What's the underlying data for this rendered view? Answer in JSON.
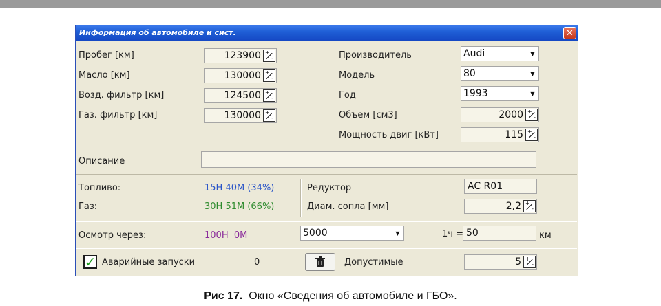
{
  "window": {
    "title": "Информация об автомобиле и сист."
  },
  "left_fields": [
    {
      "label": "Пробег [км]",
      "value": "123900"
    },
    {
      "label": "Масло [км]",
      "value": "130000"
    },
    {
      "label": "Возд. фильтр [км]",
      "value": "124500"
    },
    {
      "label": "Газ. фильтр [км]",
      "value": "130000"
    }
  ],
  "right_fields": {
    "manufacturer": {
      "label": "Производитель",
      "value": "Audi"
    },
    "model": {
      "label": "Модель",
      "value": "80"
    },
    "year": {
      "label": "Год",
      "value": "1993"
    },
    "volume": {
      "label": "Объем [см3]",
      "value": "2000"
    },
    "power": {
      "label": "Мощность двиг [кВт]",
      "value": "115"
    }
  },
  "description": {
    "label": "Описание",
    "value": ""
  },
  "fuel": {
    "fuel_label": "Топливо:",
    "fuel_value": "15Н 40М (34%)",
    "gas_label": "Газ:",
    "gas_value": "30Н 51М (66%)"
  },
  "reducer": {
    "reducer_label": "Редуктор",
    "reducer_value": "AC R01",
    "nozzle_label": "Диам. сопла [мм]",
    "nozzle_value": "2,2"
  },
  "inspection": {
    "label": "Осмотр через:",
    "value": "100Н  0М",
    "interval": "5000",
    "rate_label": "1ч =",
    "rate_value": "50",
    "unit": "км"
  },
  "emergency": {
    "label": "Аварийные запуски",
    "count": "0",
    "allowed_label": "Допустимые",
    "allowed_value": "5"
  },
  "caption": {
    "fig": "Рис 17.",
    "text": "Окно «Сведения об автомобиле и ГБО»."
  },
  "colors": {
    "fuel": "#2a55c8",
    "gas": "#2e8b2e",
    "inspection": "#8a2a9a",
    "titlebar": "#1f5fd6"
  }
}
